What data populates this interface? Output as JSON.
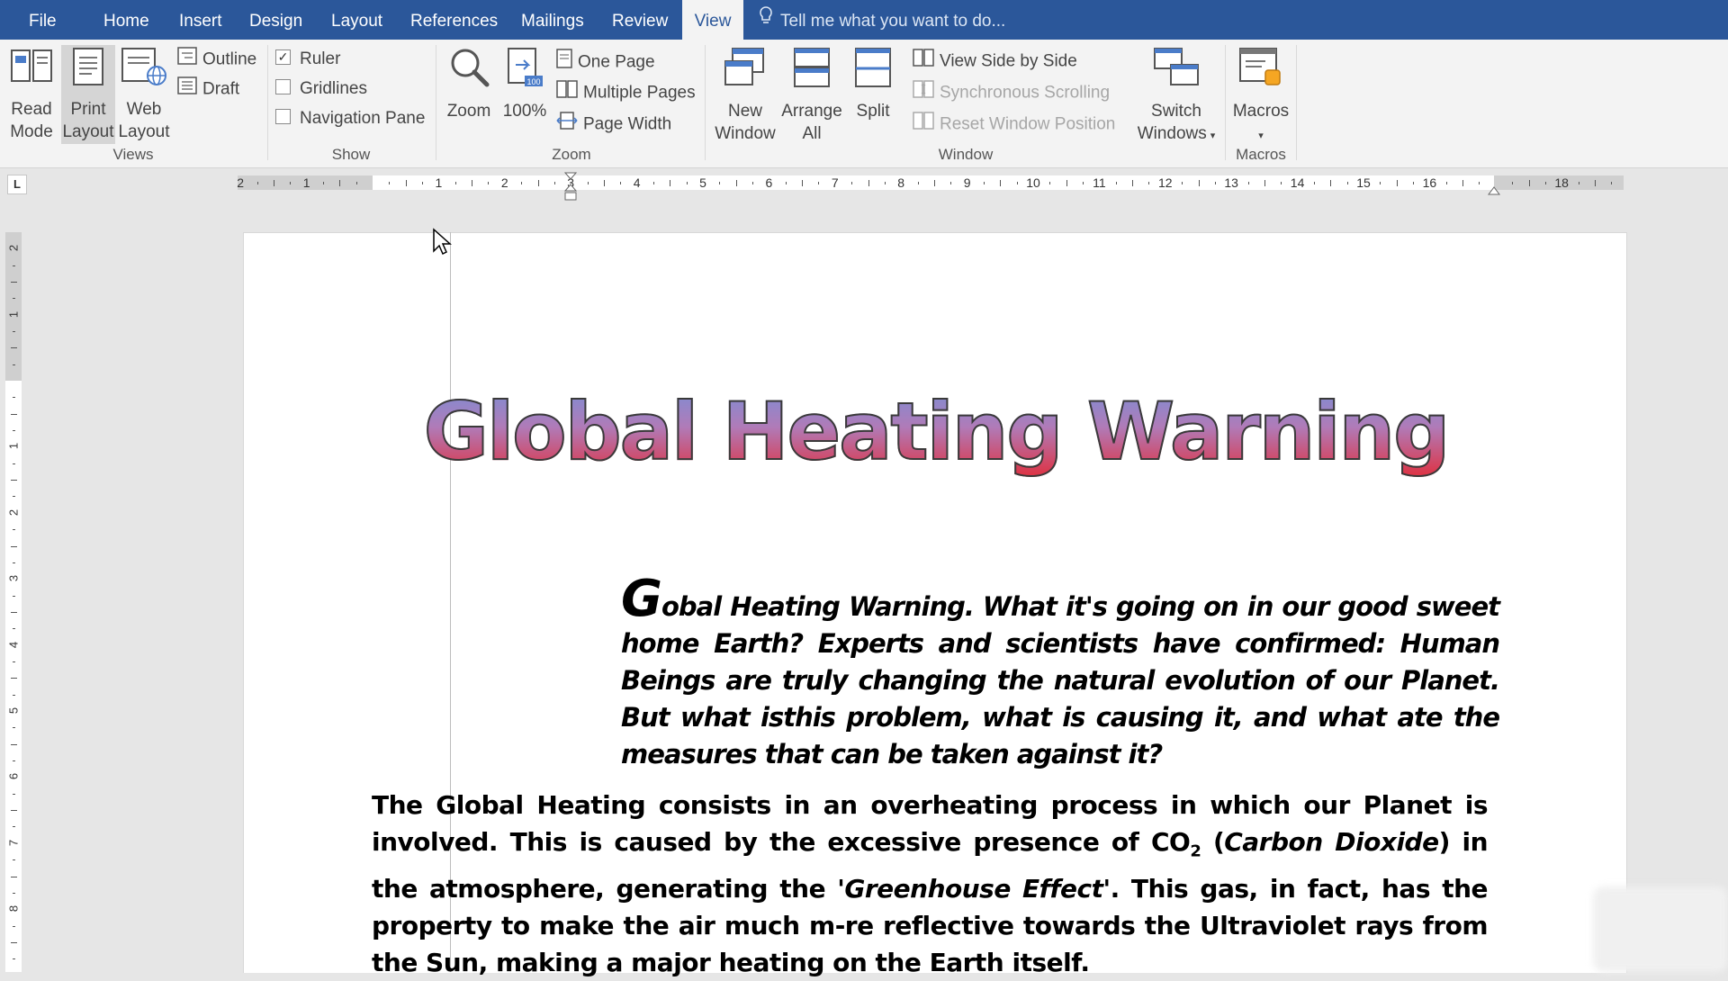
{
  "menu": {
    "tabs": [
      "File",
      "Home",
      "Insert",
      "Design",
      "Layout",
      "References",
      "Mailings",
      "Review",
      "View"
    ],
    "active_tab": "View",
    "tell_me": "Tell me what you want to do..."
  },
  "ribbon": {
    "views": {
      "read_mode": [
        "Read",
        "Mode"
      ],
      "print_layout": [
        "Print",
        "Layout"
      ],
      "web_layout": [
        "Web",
        "Layout"
      ],
      "outline": "Outline",
      "draft": "Draft",
      "label": "Views"
    },
    "show": {
      "ruler": "Ruler",
      "ruler_checked": true,
      "gridlines": "Gridlines",
      "gridlines_checked": false,
      "navigation_pane": "Navigation Pane",
      "navigation_pane_checked": false,
      "label": "Show"
    },
    "zoom": {
      "zoom": "Zoom",
      "hundred": "100%",
      "one_page": "One Page",
      "multiple_pages": "Multiple Pages",
      "page_width": "Page Width",
      "label": "Zoom"
    },
    "window": {
      "new_window": [
        "New",
        "Window"
      ],
      "arrange_all": [
        "Arrange",
        "All"
      ],
      "split": "Split",
      "view_side_by_side": "View Side by Side",
      "synchronous_scrolling": "Synchronous Scrolling",
      "reset_window_position": "Reset Window Position",
      "switch_windows": [
        "Switch",
        "Windows"
      ],
      "label": "Window"
    },
    "macros": {
      "macros": "Macros",
      "label": "Macros"
    }
  },
  "ruler": {
    "h_numbers": [
      "2",
      "1",
      "1",
      "2",
      "3",
      "4",
      "5",
      "6",
      "7",
      "8",
      "9",
      "10",
      "11",
      "12",
      "13",
      "14",
      "15",
      "16",
      "18"
    ],
    "v_numbers": [
      "2",
      "1",
      "1",
      "2",
      "3",
      "4",
      "5",
      "6",
      "7",
      "8"
    ]
  },
  "document": {
    "title": "Global Heating Warning",
    "intro_dropcap": "G",
    "intro_text": "obal Heating Warning. What it's going on in our good sweet home  Earth? Experts  and scientists have confirmed: Human Beings are truly changing the natural evolution of our Planet. But what isthis problem, what is causing it, and what ate the measures that can be taken against it?",
    "body_1": "The Global Heating consists in an overheating process in which our Planet is involved. This is caused by the excessive presence of CO",
    "body_sub": "2",
    "body_2": " (",
    "body_italic_1": "Carbon Dioxide",
    "body_3": ") in the atmosphere, generating the '",
    "body_italic_2": "Greenhouse Effect",
    "body_4": "'. This gas, in fact, has the property to make the air much m-re reflective towards the Ultraviolet rays from the Sun, making a major heating on the Earth itself."
  }
}
